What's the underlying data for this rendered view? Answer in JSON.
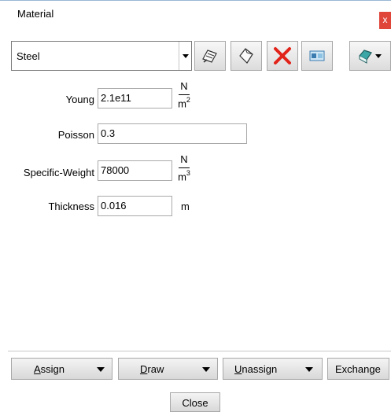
{
  "window": {
    "title": "Material",
    "close_glyph": "x"
  },
  "material_select": {
    "value": "Steel"
  },
  "toolbar": {
    "icons": [
      "edit-material-icon",
      "new-material-icon",
      "delete-material-icon",
      "import-export-icon",
      "view-options-icon"
    ]
  },
  "properties": [
    {
      "label": "Young",
      "value": "2.1e11",
      "unit_num": "N",
      "unit_den": "m",
      "unit_pow": "2"
    },
    {
      "label": "Poisson",
      "value": "0.3"
    },
    {
      "label": "Specific-Weight",
      "value": "78000",
      "unit_num": "N",
      "unit_den": "m",
      "unit_pow": "3"
    },
    {
      "label": "Thickness",
      "value": "0.016",
      "unit": "m"
    }
  ],
  "bottom_buttons": {
    "assign": {
      "first": "A",
      "rest": "ssign"
    },
    "draw": {
      "first": "D",
      "rest": "raw"
    },
    "unassign": {
      "first": "U",
      "rest": "nassign"
    },
    "exchange": "Exchange"
  },
  "close_button": {
    "first": "C",
    "rest": "lose"
  },
  "colors": {
    "delete_red": "#e2231a",
    "accent_teal": "#3aa6a6",
    "title_border": "#9ab7d4"
  }
}
